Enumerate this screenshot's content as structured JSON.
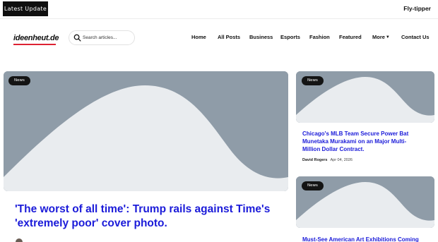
{
  "topbar": {
    "latest_label": "Latest Update",
    "ticker_text": "Fly-tipper"
  },
  "header": {
    "logo_text": "ideenheut.de",
    "search_placeholder": "Search articles..."
  },
  "nav": {
    "items": [
      "Home",
      "All Posts",
      "Business",
      "Esports",
      "Fashion",
      "Featured",
      "More",
      "Contact Us"
    ]
  },
  "hero": {
    "tag": "News",
    "title": "'The worst of all time': Trump rails against Time's 'extremely poor' cover photo."
  },
  "side_articles": [
    {
      "tag": "News",
      "title": "Chicago's MLB Team Secure Power Bat Munetaka Murakami on an Major Multi-Million Dollar Contract.",
      "author": "David Rogers",
      "date": "Apr 04, 2026"
    },
    {
      "tag": "News",
      "title": "Must-See American Art Exhibitions Coming in"
    }
  ],
  "colors": {
    "placeholder_bg": "#8f9ca8",
    "placeholder_fg": "#e9ecef",
    "link_blue": "#1b1bd9",
    "dark": "#0f0f0f"
  }
}
